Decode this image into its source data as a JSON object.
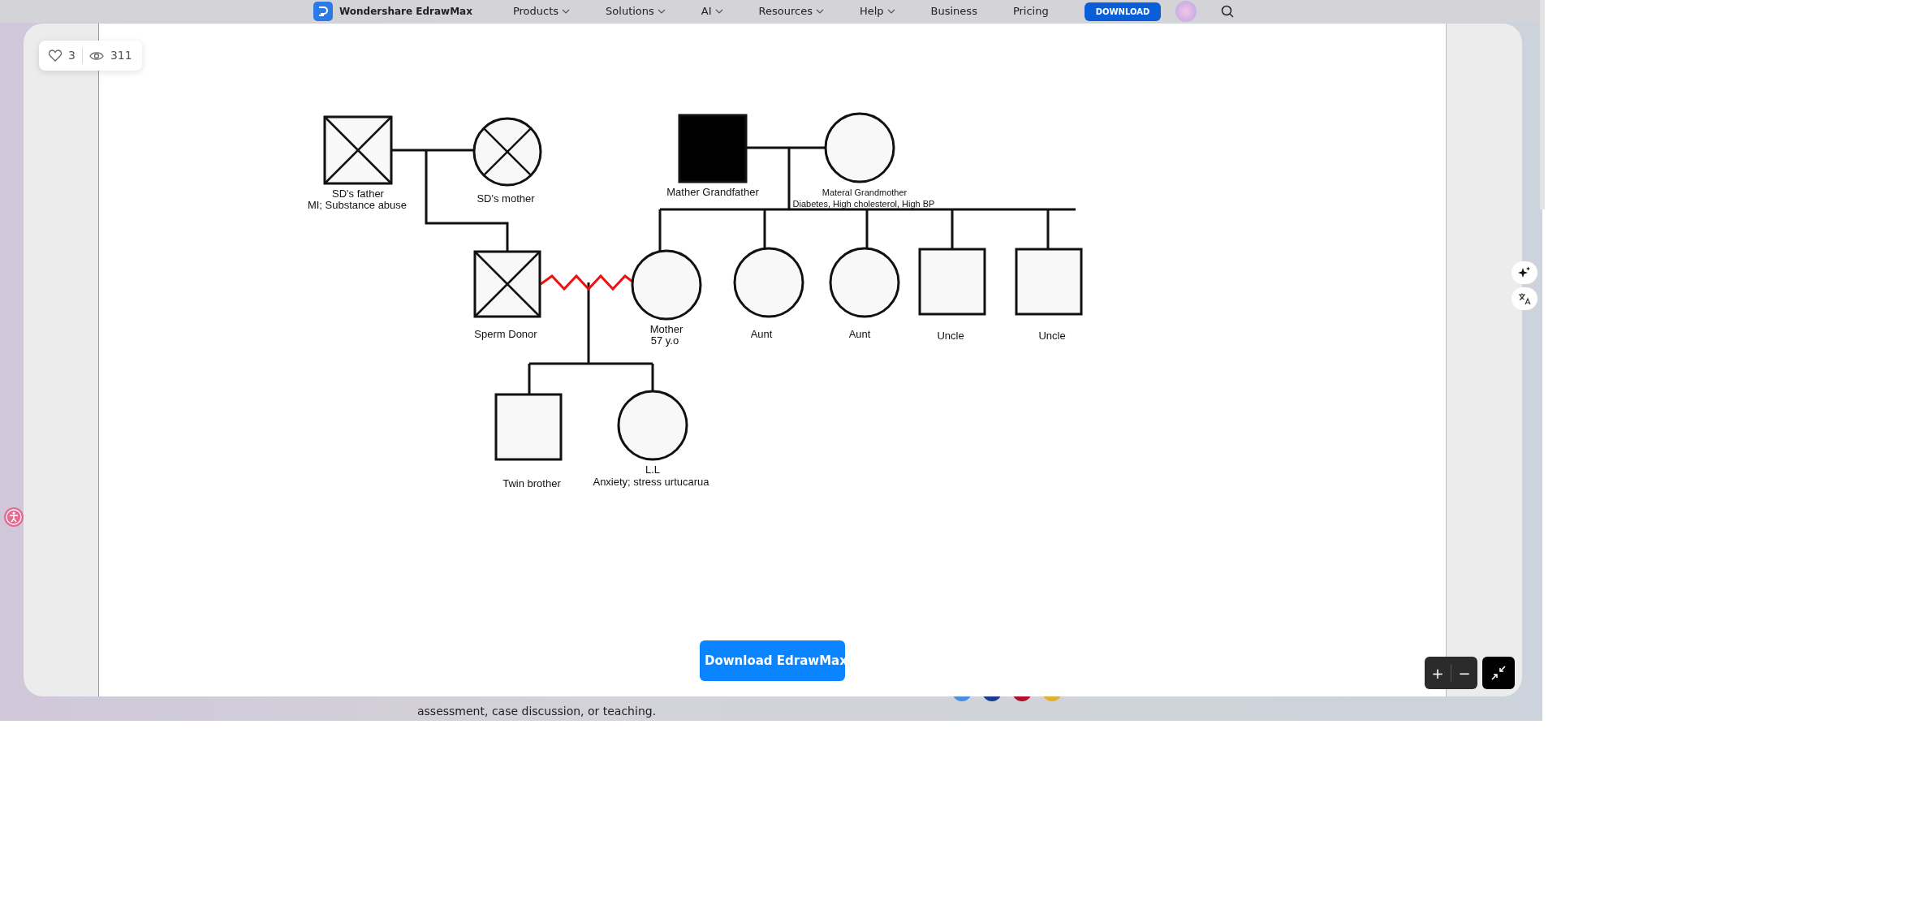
{
  "navbar": {
    "brand": "Wondershare EdrawMax",
    "items": [
      {
        "label": "Products",
        "dropdown": true
      },
      {
        "label": "Solutions",
        "dropdown": true
      },
      {
        "label": "AI",
        "dropdown": true
      },
      {
        "label": "Resources",
        "dropdown": true
      },
      {
        "label": "Help",
        "dropdown": true
      },
      {
        "label": "Business",
        "dropdown": false
      },
      {
        "label": "Pricing",
        "dropdown": false
      }
    ],
    "download_button": "DOWNLOAD"
  },
  "page_text": "assessment, case discussion, or teaching.",
  "viewer": {
    "stats": {
      "likes": "3",
      "views": "311"
    },
    "diagram": {
      "people": [
        {
          "kind": "male",
          "crossed": true,
          "filled": false,
          "lines": [
            "SD's father",
            "MI; Substance abuse"
          ]
        },
        {
          "kind": "female",
          "crossed": true,
          "filled": false,
          "lines": [
            "SD's mother"
          ]
        },
        {
          "kind": "male",
          "crossed": false,
          "filled": true,
          "lines": [
            "Mather Grandfather"
          ]
        },
        {
          "kind": "female",
          "crossed": false,
          "filled": false,
          "lines": [
            "Materal Grandmother",
            "Diabetes, High cholesterol, High BP"
          ]
        },
        {
          "kind": "male",
          "crossed": true,
          "filled": false,
          "lines": [
            "Sperm Donor"
          ]
        },
        {
          "kind": "female",
          "crossed": false,
          "filled": false,
          "lines": [
            "Mother",
            "57 y.o"
          ]
        },
        {
          "kind": "female",
          "crossed": false,
          "filled": false,
          "lines": [
            "Aunt"
          ]
        },
        {
          "kind": "female",
          "crossed": false,
          "filled": false,
          "lines": [
            "Aunt"
          ]
        },
        {
          "kind": "male",
          "crossed": false,
          "filled": false,
          "lines": [
            "Uncle"
          ]
        },
        {
          "kind": "male",
          "crossed": false,
          "filled": false,
          "lines": [
            "Uncle"
          ]
        },
        {
          "kind": "male",
          "crossed": false,
          "filled": false,
          "lines": [
            "Twin brother"
          ]
        },
        {
          "kind": "female",
          "crossed": false,
          "filled": false,
          "lines": [
            "L.L",
            "Anxiety; stress urtucarua"
          ]
        }
      ]
    },
    "download_button": "Download EdrawMax",
    "zoom_in": "+",
    "zoom_out": "−"
  }
}
